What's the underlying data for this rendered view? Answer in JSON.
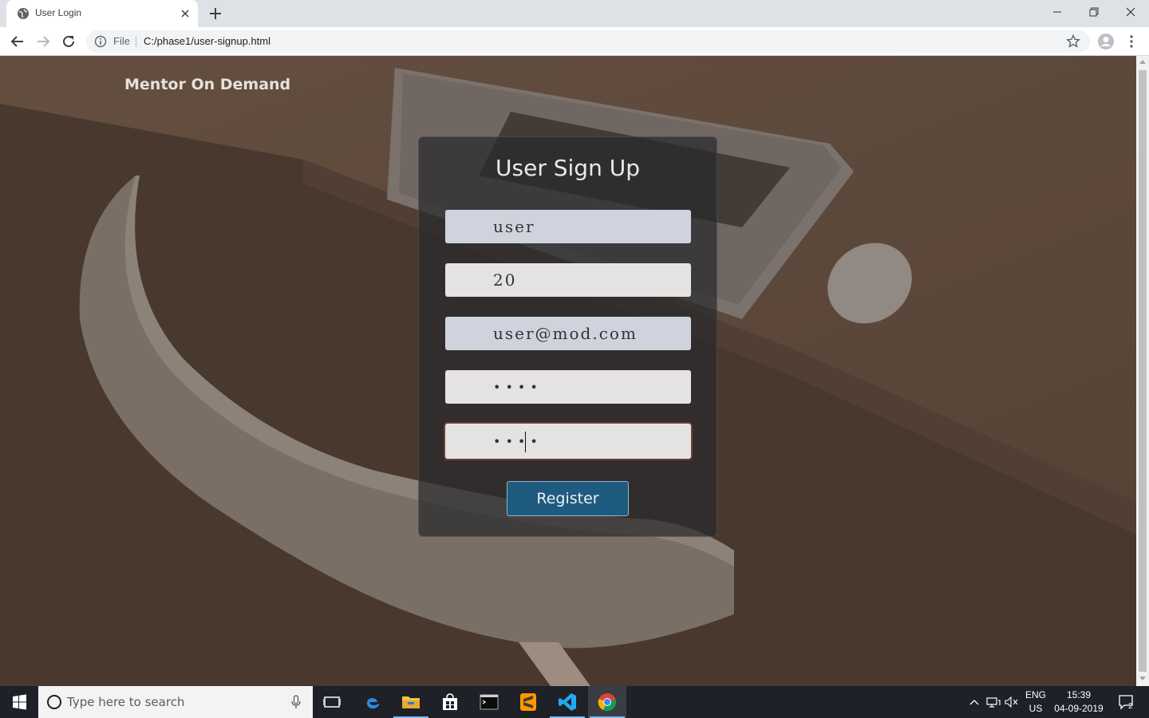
{
  "browser": {
    "tab_title": "User Login",
    "omnibox_scheme": "File",
    "url": "C:/phase1/user-signup.html",
    "icons": {
      "favicon": "globe-icon",
      "close": "close-icon",
      "new_tab": "plus-icon",
      "back": "back-arrow-icon",
      "forward": "forward-arrow-icon",
      "reload": "reload-icon",
      "info": "info-icon",
      "bookmark": "star-icon",
      "profile": "avatar-icon",
      "menu": "kebab-menu-icon"
    }
  },
  "page": {
    "brand": "Mentor On Demand",
    "form": {
      "title": "User Sign Up",
      "fields": [
        {
          "name": "username",
          "value": "user"
        },
        {
          "name": "age",
          "value": "20"
        },
        {
          "name": "email",
          "value": "user@mod.com"
        },
        {
          "name": "password",
          "value": "••••"
        },
        {
          "name": "confirm-password",
          "value": "••••"
        }
      ],
      "submit_label": "Register"
    },
    "colors": {
      "button": "#1f5a7f",
      "focus_ring": "#6b3f36",
      "background": "#4d3d32"
    }
  },
  "taskbar": {
    "search_placeholder": "Type here to search",
    "language_line1": "ENG",
    "language_line2": "US",
    "time": "15:39",
    "date": "04-09-2019",
    "notification_count": "2",
    "apps": [
      "task-view-icon",
      "edge-icon",
      "file-explorer-icon",
      "store-icon",
      "terminal-icon",
      "sublime-icon",
      "vscode-icon",
      "chrome-icon"
    ]
  }
}
